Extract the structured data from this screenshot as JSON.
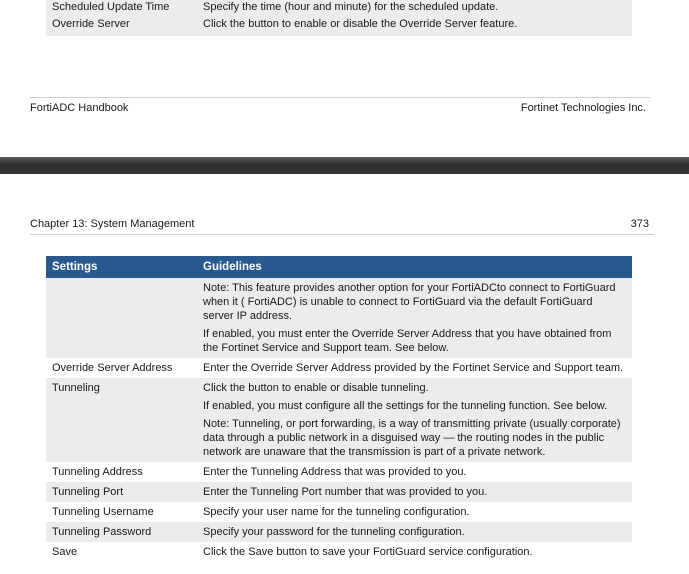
{
  "top_page": {
    "rows": [
      {
        "setting": "Scheduled Update Time",
        "guidelines": [
          "Specify the time (hour and minute) for the scheduled update."
        ]
      },
      {
        "setting": "Override Server",
        "guidelines": [
          "Click the button to enable or disable the Override Server feature."
        ]
      }
    ],
    "footer": {
      "left": "FortiADC Handbook",
      "right": "Fortinet Technologies Inc."
    }
  },
  "bottom_page": {
    "header": {
      "chapter": "Chapter 13: System Management",
      "page_number": "373"
    },
    "table": {
      "columns": [
        "Settings",
        "Guidelines"
      ],
      "rows": [
        {
          "setting": "",
          "guidelines": [
            "Note: This feature provides another option for your FortiADCto connect to FortiGuard when it ( FortiADC) is unable to connect to FortiGuard via the default FortiGuard server IP address.",
            "If enabled, you must enter the Override Server Address that you have obtained from the Fortinet Service and Support team. See below."
          ]
        },
        {
          "setting": "Override Server Address",
          "guidelines": [
            "Enter the Override Server Address provided by the Fortinet Service and Support team."
          ]
        },
        {
          "setting": "Tunneling",
          "guidelines": [
            "Click the button to enable or disable tunneling.",
            "If enabled, you must configure all the settings for the tunneling function. See below.",
            "Note: Tunneling, or port forwarding, is a way of transmitting private (usually corporate) data through a public network in a disguised way — the routing nodes in the public network are unaware that the transmission is part of a private network."
          ]
        },
        {
          "setting": "Tunneling Address",
          "guidelines": [
            "Enter the Tunneling Address that was provided to you."
          ]
        },
        {
          "setting": "Tunneling Port",
          "guidelines": [
            "Enter the Tunneling Port number that was provided to you."
          ]
        },
        {
          "setting": "Tunneling Username",
          "guidelines": [
            "Specify your user name for the tunneling configuration."
          ]
        },
        {
          "setting": "Tunneling Password",
          "guidelines": [
            "Specify your password for the tunneling configuration."
          ]
        },
        {
          "setting": "Save",
          "guidelines": [
            "Click the Save button to save your FortiGuard service configuration."
          ]
        }
      ]
    }
  }
}
